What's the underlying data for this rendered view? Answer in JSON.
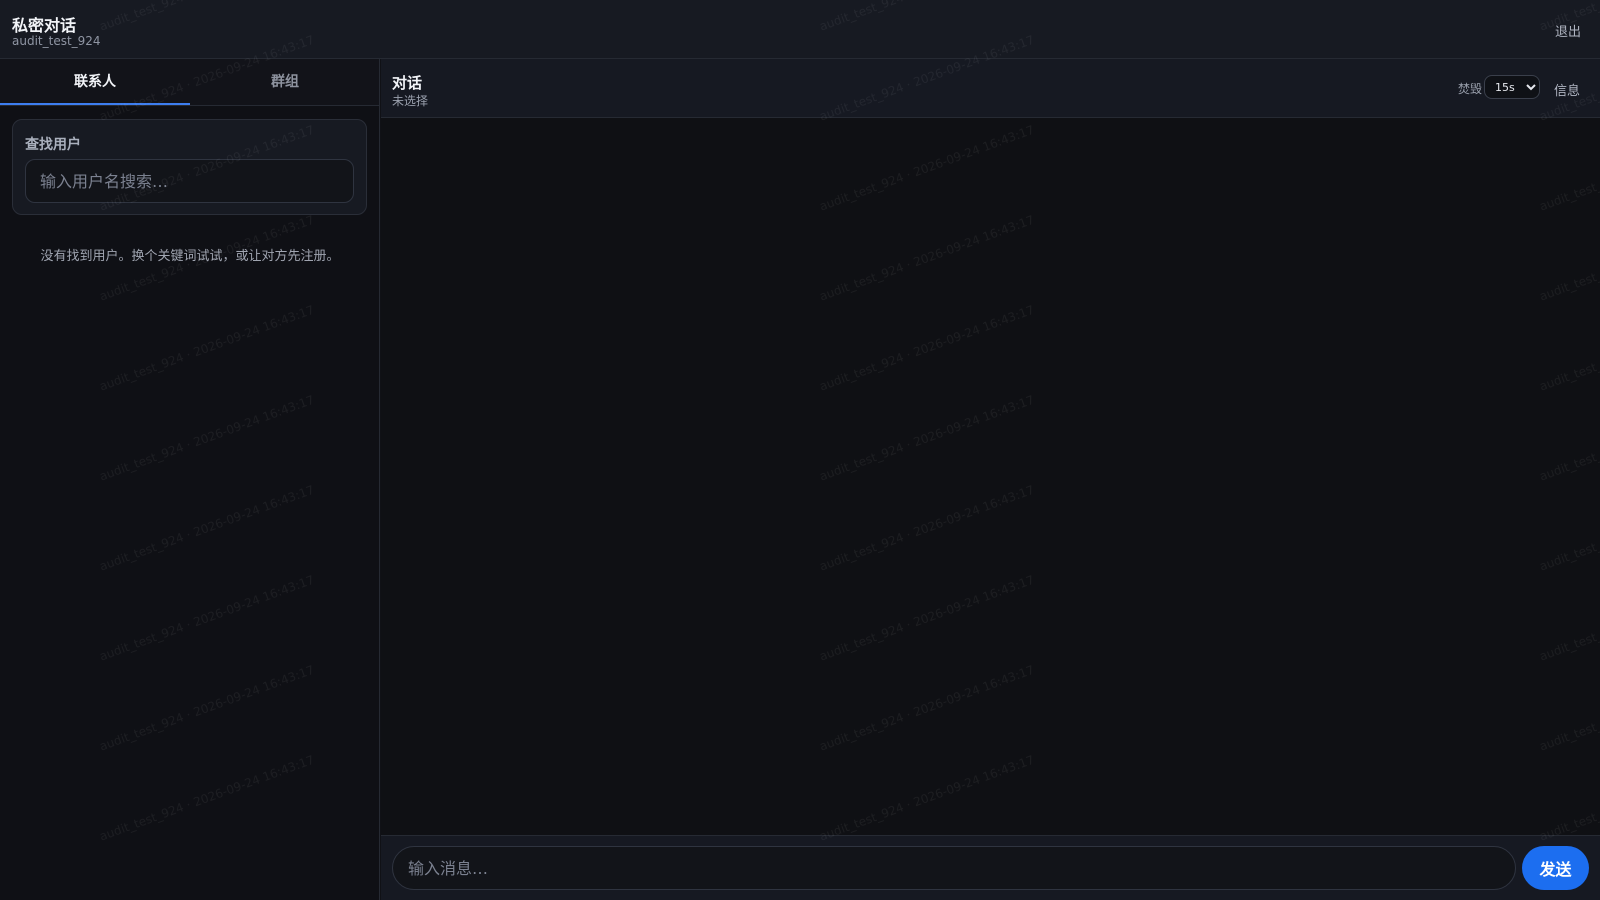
{
  "app": {
    "title": "私密对话",
    "username": "audit_test_924",
    "logout_label": "退出"
  },
  "sidebar": {
    "tabs": [
      {
        "label": "联系人",
        "active": true
      },
      {
        "label": "群组",
        "active": false
      }
    ],
    "search": {
      "label": "查找用户",
      "placeholder": "输入用户名搜索…"
    },
    "empty_message": "没有找到用户。换个关键词试试，或让对方先注册。"
  },
  "chat": {
    "title": "对话",
    "subtitle": "未选择",
    "burn_label": "焚毁",
    "burn_options": [
      "15s"
    ],
    "burn_selected": "15s",
    "info_label": "信息"
  },
  "composer": {
    "placeholder": "输入消息…",
    "send_label": "发送"
  },
  "watermark": {
    "text": "audit_test_924 · 2026-09-24 16:43:17"
  },
  "colors": {
    "accent": "#1c6ef0",
    "tab_underline": "#3d7ef0",
    "background": "#101116"
  }
}
